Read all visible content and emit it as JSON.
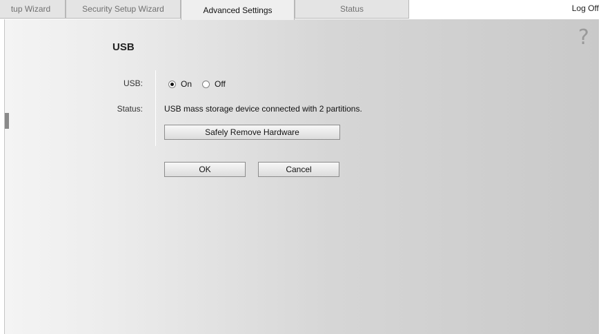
{
  "tabs": [
    {
      "label": "tup Wizard",
      "active": false
    },
    {
      "label": "Security Setup Wizard",
      "active": false
    },
    {
      "label": "Advanced Settings",
      "active": true
    },
    {
      "label": "Status",
      "active": false
    }
  ],
  "header": {
    "logoff_label": "Log Off"
  },
  "help": {
    "icon": "question-mark-icon",
    "glyph": "?"
  },
  "section": {
    "title": "USB"
  },
  "form": {
    "usb_label": "USB:",
    "usb_options": [
      {
        "label": "On",
        "checked": true
      },
      {
        "label": "Off",
        "checked": false
      }
    ],
    "status_label": "Status:",
    "status_text": "USB mass storage device connected with 2 partitions.",
    "safe_remove_label": "Safely Remove Hardware"
  },
  "actions": {
    "ok_label": "OK",
    "cancel_label": "Cancel"
  }
}
